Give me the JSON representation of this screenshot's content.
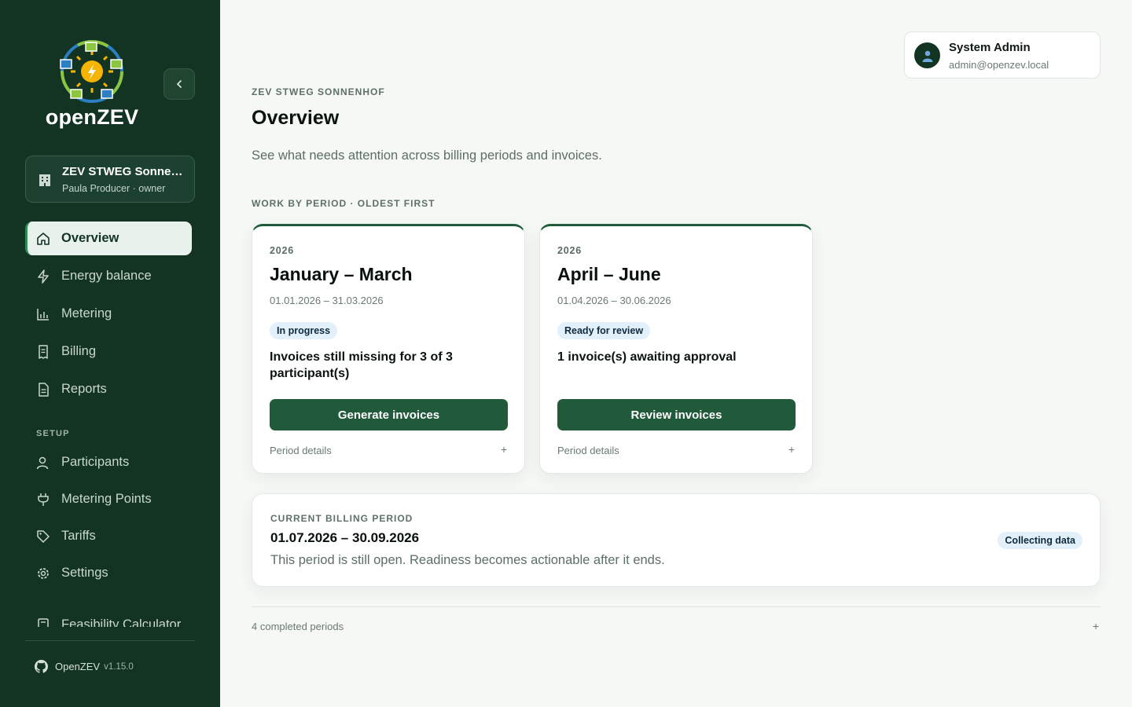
{
  "app": {
    "logo_text": "openZEV",
    "colors": {
      "sidebar": "#133323",
      "accent": "#215a3b",
      "badge": "#e2f0fb"
    }
  },
  "sidebar": {
    "zev_selector": {
      "name": "ZEV STWEG Sonnenhof",
      "subtitle": "Paula Producer · owner"
    },
    "nav": [
      {
        "label": "Overview",
        "icon": "home-icon",
        "active": true
      },
      {
        "label": "Energy balance",
        "icon": "bolt-icon"
      },
      {
        "label": "Metering",
        "icon": "bar-chart-icon"
      },
      {
        "label": "Billing",
        "icon": "receipt-icon"
      },
      {
        "label": "Reports",
        "icon": "document-icon"
      }
    ],
    "setup_label": "SETUP",
    "setup_nav": [
      {
        "label": "Participants",
        "icon": "user-icon"
      },
      {
        "label": "Metering Points",
        "icon": "plug-icon"
      },
      {
        "label": "Tariffs",
        "icon": "tag-icon"
      },
      {
        "label": "Settings",
        "icon": "gear-icon"
      },
      {
        "label": "Feasibility Calculator",
        "icon": "calculator-icon"
      }
    ],
    "footer": {
      "name": "OpenZEV",
      "version": "v1.15.0"
    }
  },
  "user": {
    "name": "System Admin",
    "email": "admin@openzev.local"
  },
  "page": {
    "eyebrow": "ZEV STWEG SONNENHOF",
    "title": "Overview",
    "description": "See what needs attention across billing periods and invoices.",
    "section_heading": "WORK BY PERIOD · OLDEST FIRST"
  },
  "periods": [
    {
      "year": "2026",
      "title": "January – March",
      "dates": "01.01.2026 – 31.03.2026",
      "status": "In progress",
      "message": "Invoices still missing for 3 of 3 participant(s)",
      "action": "Generate invoices",
      "details": "Period details",
      "expand": "+"
    },
    {
      "year": "2026",
      "title": "April – June",
      "dates": "01.04.2026 – 30.06.2026",
      "status": "Ready for review",
      "message": "1 invoice(s) awaiting approval",
      "action": "Review invoices",
      "details": "Period details",
      "expand": "+"
    }
  ],
  "current_period": {
    "eyebrow": "CURRENT BILLING PERIOD",
    "range": "01.07.2026 – 30.09.2026",
    "note": "This period is still open. Readiness becomes actionable after it ends.",
    "status": "Collecting data"
  },
  "completed": {
    "label": "4 completed periods",
    "expand": "+"
  }
}
